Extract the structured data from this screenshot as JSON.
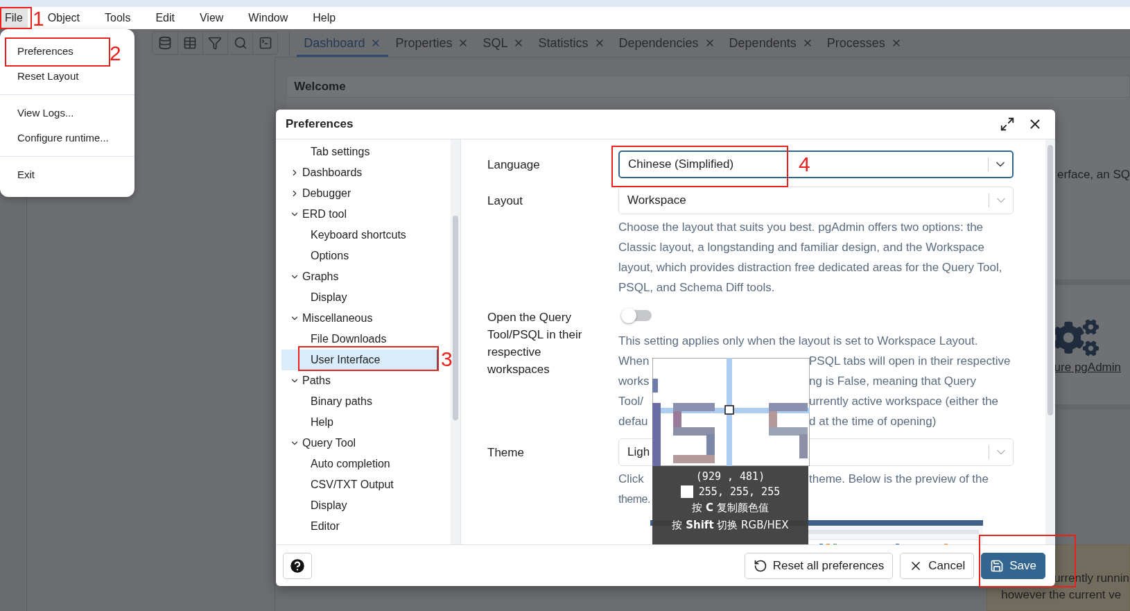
{
  "menubar": [
    {
      "label": "File",
      "selected": true
    },
    {
      "label": "Object",
      "selected": false
    },
    {
      "label": "Tools",
      "selected": false
    },
    {
      "label": "Edit",
      "selected": false
    },
    {
      "label": "View",
      "selected": false
    },
    {
      "label": "Window",
      "selected": false
    },
    {
      "label": "Help",
      "selected": false
    }
  ],
  "file_menu": [
    [
      "Preferences",
      "Reset Layout"
    ],
    [
      "View Logs...",
      "Configure runtime..."
    ],
    [
      "Exit"
    ]
  ],
  "tabs": [
    {
      "label": "Dashboard",
      "selected": true
    },
    {
      "label": "Properties",
      "selected": false
    },
    {
      "label": "SQL",
      "selected": false
    },
    {
      "label": "Statistics",
      "selected": false
    },
    {
      "label": "Dependencies",
      "selected": false
    },
    {
      "label": "Dependents",
      "selected": false
    },
    {
      "label": "Processes",
      "selected": false
    }
  ],
  "dashboard": {
    "title": "Welcome",
    "intro_fragment": "erface, an SQ",
    "link_fragment": "ure pgAdmin",
    "warning_lines": [
      "urrently runnin",
      "however the current ve"
    ]
  },
  "dialog": {
    "title": "Preferences",
    "tree": [
      {
        "children": [
          {
            "label": "Tab settings",
            "selected": false
          }
        ]
      },
      {
        "label": "Dashboards",
        "expanded": false,
        "selected": false
      },
      {
        "label": "Debugger",
        "expanded": false,
        "selected": false
      },
      {
        "label": "ERD tool",
        "expanded": true,
        "selected": false,
        "children": [
          {
            "label": "Keyboard shortcuts",
            "selected": false
          },
          {
            "label": "Options",
            "selected": false
          }
        ]
      },
      {
        "label": "Graphs",
        "expanded": true,
        "selected": false,
        "children": [
          {
            "label": "Display",
            "selected": false
          }
        ]
      },
      {
        "label": "Miscellaneous",
        "expanded": true,
        "selected": false,
        "children": [
          {
            "label": "File Downloads",
            "selected": false
          },
          {
            "label": "User Interface",
            "selected": true
          }
        ]
      },
      {
        "label": "Paths",
        "expanded": true,
        "selected": false,
        "children": [
          {
            "label": "Binary paths",
            "selected": false
          },
          {
            "label": "Help",
            "selected": false
          }
        ]
      },
      {
        "label": "Query Tool",
        "expanded": true,
        "selected": false,
        "children": [
          {
            "label": "Auto completion",
            "selected": false
          },
          {
            "label": "CSV/TXT Output",
            "selected": false
          },
          {
            "label": "Display",
            "selected": false
          },
          {
            "label": "Editor",
            "selected": false
          }
        ]
      }
    ],
    "settings": [
      {
        "kind": "select",
        "label": "Language",
        "value": "Chinese (Simplified)",
        "focused": true
      },
      {
        "kind": "select",
        "label": "Layout",
        "value": "Workspace",
        "focused": false,
        "help": "Choose the layout that suits you best. pgAdmin offers two options: the Classic layout, a longstanding and familiar design, and the Workspace layout, which provides distraction free dedicated areas for the Query Tool, PSQL, and Schema Diff tools."
      },
      {
        "kind": "switch",
        "label": "Open the Query Tool/PSQL in their respective workspaces",
        "on": false,
        "help": "This setting applies only when the layout is set to Workspace Layout.",
        "help_lines": [
          {
            "left": "When",
            "right": "PSQL tabs will open in their respective"
          },
          {
            "left": "works",
            "right": "ng is False, meaning that Query"
          },
          {
            "left": "Tool/",
            "right": "urrently active workspace (either the"
          },
          {
            "left": "defau",
            "right": "d at the time of opening)"
          }
        ]
      },
      {
        "kind": "select",
        "label": "Theme",
        "value": "Ligh",
        "focused": false,
        "help_lines": [
          {
            "left": "Click",
            "right": "theme. Below is the preview of the"
          },
          {
            "left": "theme."
          }
        ]
      },
      {
        "kind": "preview"
      }
    ],
    "buttons": [
      {
        "kind": "help"
      },
      {
        "kind": "reset",
        "label": "Reset all preferences"
      },
      {
        "kind": "cancel",
        "label": "Cancel"
      },
      {
        "kind": "save",
        "label": "Save"
      }
    ]
  },
  "color_picker": {
    "coords": "(929 , 481)",
    "rgb": "255, 255, 255",
    "hints": [
      "按 **C** 复制颜色值",
      "按 **Shift** 切换 RGB/HEX"
    ]
  },
  "annotations": [
    {
      "kind": "numbered",
      "label": "1"
    },
    {
      "kind": "numbered",
      "label": "2"
    },
    {
      "kind": "numbered",
      "label": "3"
    },
    {
      "kind": "numbered",
      "label": "4"
    },
    {
      "kind": "frame"
    }
  ]
}
